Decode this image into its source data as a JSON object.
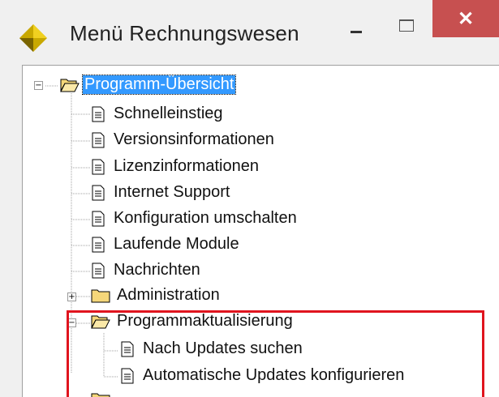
{
  "window": {
    "title": "Menü Rechnungswesen",
    "close_glyph": "✕"
  },
  "icons": {
    "app": "diamond-app-icon",
    "folder_open": "folder-open-icon",
    "folder_closed": "folder-icon",
    "document": "document-icon"
  },
  "colors": {
    "selection": "#3399ff",
    "highlight_box": "#e0141e",
    "close_button": "#c75050"
  },
  "tree": {
    "root": "Programm-Übersicht",
    "items": [
      "Schnelleinstieg",
      "Versionsinformationen",
      "Lizenzinformationen",
      "Internet Support",
      "Konfiguration umschalten",
      "Laufende Module",
      "Nachrichten"
    ],
    "folder_admin": "Administration",
    "folder_updates": "Programmaktualisierung",
    "update_items": [
      "Nach Updates suchen",
      "Automatische Updates konfigurieren"
    ]
  }
}
